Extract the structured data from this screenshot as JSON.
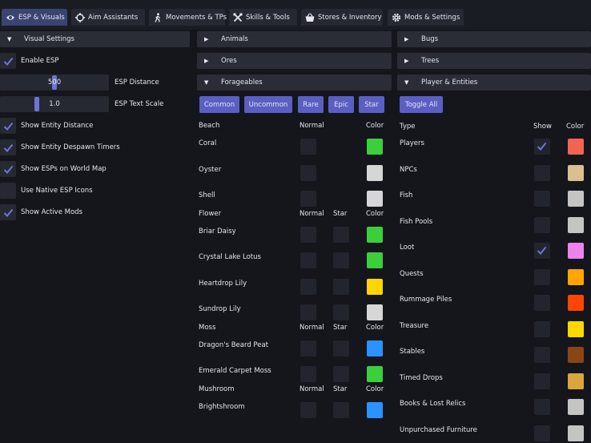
{
  "tabs": [
    {
      "label": "ESP & Visuals",
      "icon": "eye-icon",
      "active": true
    },
    {
      "label": "Aim Assistants",
      "icon": "crosshair-icon",
      "active": false
    },
    {
      "label": "Movements & TPs",
      "icon": "walking-person-icon",
      "active": false
    },
    {
      "label": "Skills & Tools",
      "icon": "tools-icon",
      "active": false
    },
    {
      "label": "Stores & Inventory",
      "icon": "shopping-basket-icon",
      "active": false
    },
    {
      "label": "Mods & Settings",
      "icon": "gear-icon",
      "active": false
    }
  ],
  "visual_settings": {
    "header": "Visual Settings",
    "enable_esp": {
      "label": "Enable ESP",
      "checked": true
    },
    "esp_distance": {
      "label": "ESP Distance",
      "value": "500",
      "fraction": 0.5
    },
    "esp_text_scale": {
      "label": "ESP Text Scale",
      "value": "1.0",
      "fraction": 0.33
    },
    "options": [
      {
        "label": "Show Entity Distance",
        "checked": true
      },
      {
        "label": "Show Entity Despawn Timers",
        "checked": true
      },
      {
        "label": "Show ESPs on World Map",
        "checked": true
      },
      {
        "label": "Use Native ESP Icons",
        "checked": false
      },
      {
        "label": "Show Active Mods",
        "checked": true
      }
    ]
  },
  "middle": {
    "animals_header": "Animals",
    "ores_header": "Ores",
    "forageables_header": "Forageables",
    "rarity_buttons": [
      "Common",
      "Uncommon",
      "Rare",
      "Epic",
      "Star"
    ],
    "col_normal": "Normal",
    "col_star": "Star",
    "col_color": "Color",
    "groups": [
      {
        "name": "Beach",
        "has_star": false,
        "items": [
          {
            "label": "Coral",
            "color": "#3ccf3c"
          },
          {
            "label": "Oyster",
            "color": "#d6d6d6"
          },
          {
            "label": "Shell",
            "color": "#d6d6d6"
          }
        ]
      },
      {
        "name": "Flower",
        "has_star": true,
        "items": [
          {
            "label": "Briar Daisy",
            "color": "#3ccf3c"
          },
          {
            "label": "Crystal Lake Lotus",
            "color": "#3ccf3c"
          },
          {
            "label": "Heartdrop Lily",
            "color": "#ffd500"
          },
          {
            "label": "Sundrop Lily",
            "color": "#d6d6d6"
          }
        ]
      },
      {
        "name": "Moss",
        "has_star": true,
        "items": [
          {
            "label": "Dragon's Beard Peat",
            "color": "#2a93ff"
          },
          {
            "label": "Emerald Carpet Moss",
            "color": "#3ccf3c"
          }
        ]
      },
      {
        "name": "Mushroom",
        "has_star": true,
        "items": [
          {
            "label": "Brightshroom",
            "color": "#2a93ff"
          }
        ]
      }
    ]
  },
  "right": {
    "bugs_header": "Bugs",
    "trees_header": "Trees",
    "player_entities_header": "Player & Entities",
    "toggle_all": "Toggle All",
    "col_type": "Type",
    "col_show": "Show",
    "col_color": "Color",
    "items": [
      {
        "label": "Players",
        "show": true,
        "color": "#f26450"
      },
      {
        "label": "NPCs",
        "show": false,
        "color": "#dcbf8e"
      },
      {
        "label": "Fish",
        "show": false,
        "color": "#c4c4c4"
      },
      {
        "label": "Fish Pools",
        "show": false,
        "color": "#c4c4c4"
      },
      {
        "label": "Loot",
        "show": true,
        "color": "#ee82ee"
      },
      {
        "label": "Quests",
        "show": false,
        "color": "#ffa500"
      },
      {
        "label": "Rummage Piles",
        "show": false,
        "color": "#ff4500"
      },
      {
        "label": "Treasure",
        "show": false,
        "color": "#ffd700"
      },
      {
        "label": "Stables",
        "show": false,
        "color": "#8b4513"
      },
      {
        "label": "Timed Drops",
        "show": false,
        "color": "#daa53c"
      },
      {
        "label": "Books & Lost Relics",
        "show": false,
        "color": "#c4c4c4"
      },
      {
        "label": "Unpurchased Furniture",
        "show": false,
        "color": "#c4c4c4"
      }
    ]
  }
}
